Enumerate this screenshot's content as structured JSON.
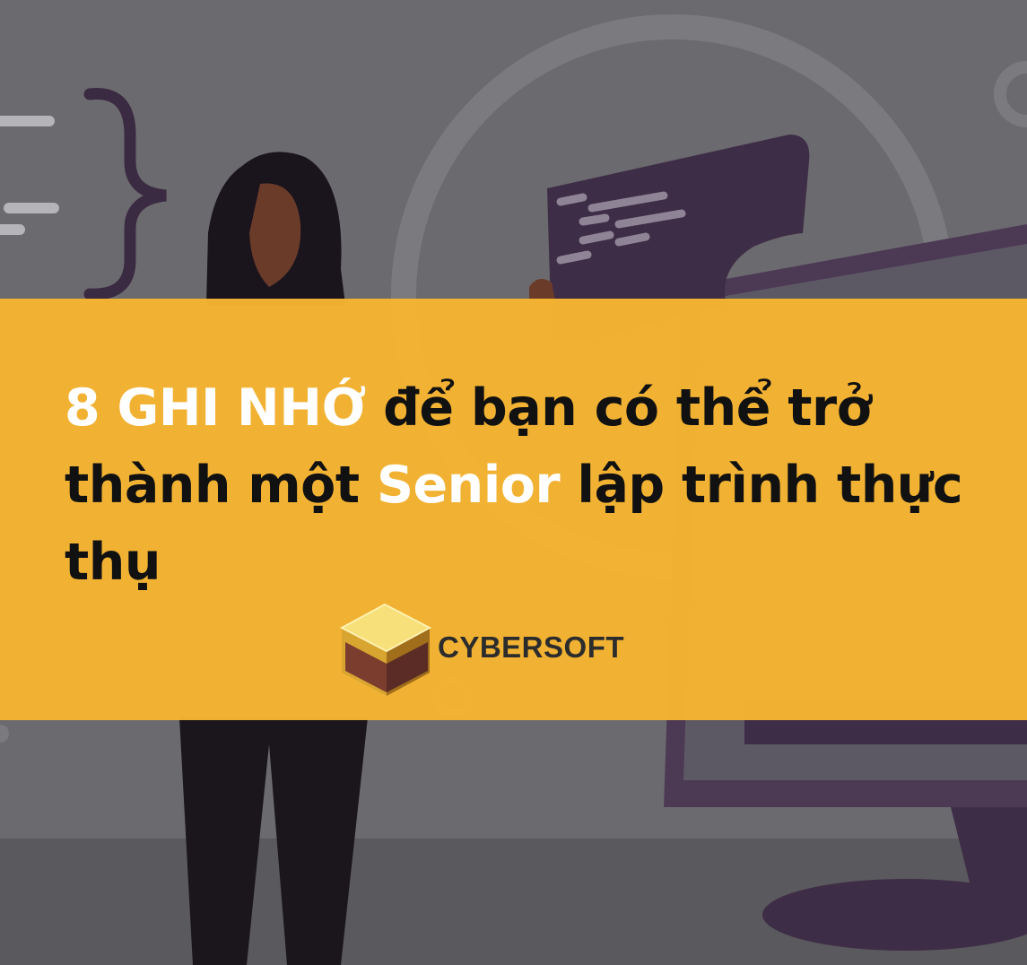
{
  "headline": {
    "part1": "8 GHI NHỚ",
    "part2": " để bạn có thể trở thành một ",
    "part3": "Senior",
    "part4": " lập trình thực thụ"
  },
  "logo": {
    "brand": "CYBERSOFT",
    "icon": "gold-cube-icon"
  },
  "colors": {
    "banner": "#f6b532",
    "background": "#6b6a6e",
    "highlight_text": "#ffffff",
    "body_text": "#111111"
  }
}
